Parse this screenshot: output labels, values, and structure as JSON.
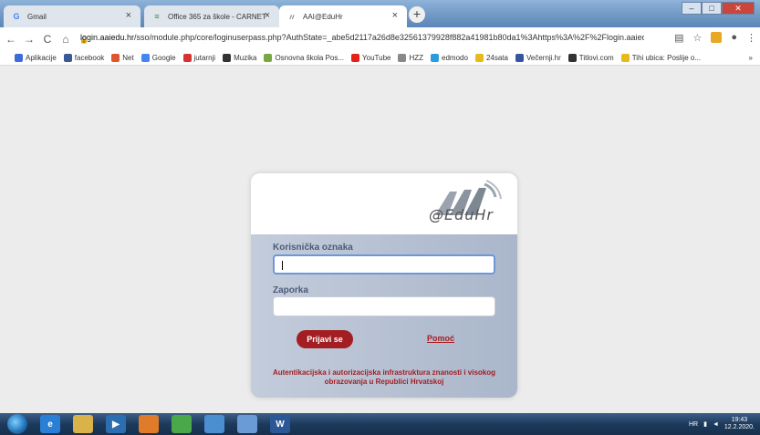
{
  "tabs": [
    {
      "title": "Gmail",
      "icon": "gmail-icon",
      "icon_glyph": "G",
      "active": false
    },
    {
      "title": "Office 365 za škole - CARNET",
      "icon": "list-icon",
      "icon_glyph": "≡",
      "active": false
    },
    {
      "title": "AAI@EduHr",
      "icon": "aai-icon",
      "icon_glyph": "〃",
      "active": true
    }
  ],
  "tab_close_glyph": "×",
  "new_tab_glyph": "+",
  "window_controls": {
    "minimize": "–",
    "maximize": "□",
    "close": "✕"
  },
  "address": {
    "url_host": "login.aaiedu.hr",
    "url_path": "/sso/module.php/core/loginuserpass.php?AuthState=_abe5d2117a26d8e32561379928f882a41981b80da1%3Ahttps%3A%2F%2Flogin.aaiedu.hr%..."
  },
  "nav": {
    "back": "←",
    "forward": "→",
    "reload": "C",
    "home": "⌂",
    "lock": "🔒"
  },
  "bookmarks": [
    {
      "label": "Aplikacije",
      "color": "#3d6bd8"
    },
    {
      "label": "facebook",
      "color": "#3b5998"
    },
    {
      "label": "Net",
      "color": "#e0552d"
    },
    {
      "label": "Google",
      "color": "#4285f4"
    },
    {
      "label": "jutarnji",
      "color": "#d7322f"
    },
    {
      "label": "Muzika",
      "color": "#333333"
    },
    {
      "label": "Osnovna škola Pos...",
      "color": "#7aa644"
    },
    {
      "label": "YouTube",
      "color": "#e62117"
    },
    {
      "label": "HZZ",
      "color": "#888888"
    },
    {
      "label": "edmodo",
      "color": "#2b9be0"
    },
    {
      "label": "24sata",
      "color": "#e8b91a"
    },
    {
      "label": "Večernji.hr",
      "color": "#3555a0"
    },
    {
      "label": "Titlovi.com",
      "color": "#333333"
    },
    {
      "label": "Tihi ubica: Poslije o...",
      "color": "#e8b91a"
    }
  ],
  "bookmarks_overflow": "»",
  "login": {
    "logo_text": "@EduHr",
    "username_label": "Korisnička oznaka",
    "username_value": "",
    "password_label": "Zaporka",
    "password_value": "",
    "submit_label": "Prijavi se",
    "help_label": "Pomoć",
    "footnote": "Autentikacijska i autorizacijska infrastruktura znanosti i visokog obrazovanja u Republici Hrvatskoj"
  },
  "taskbar": {
    "apps": [
      {
        "name": "ie-icon",
        "color": "#2a7fd4",
        "label": "e"
      },
      {
        "name": "explorer-icon",
        "color": "#d9b24a",
        "label": ""
      },
      {
        "name": "media-icon",
        "color": "#2c6fb0",
        "label": "▶"
      },
      {
        "name": "firefox-icon",
        "color": "#e07b2a",
        "label": ""
      },
      {
        "name": "chrome-icon",
        "color": "#4aa84a",
        "label": ""
      },
      {
        "name": "app-icon",
        "color": "#4b8fd0",
        "label": ""
      },
      {
        "name": "paint-icon",
        "color": "#6b9bd6",
        "label": ""
      },
      {
        "name": "word-icon",
        "color": "#2b5797",
        "label": "W"
      }
    ],
    "lang": "HR",
    "time": "19:43",
    "date": "12.2.2020."
  }
}
